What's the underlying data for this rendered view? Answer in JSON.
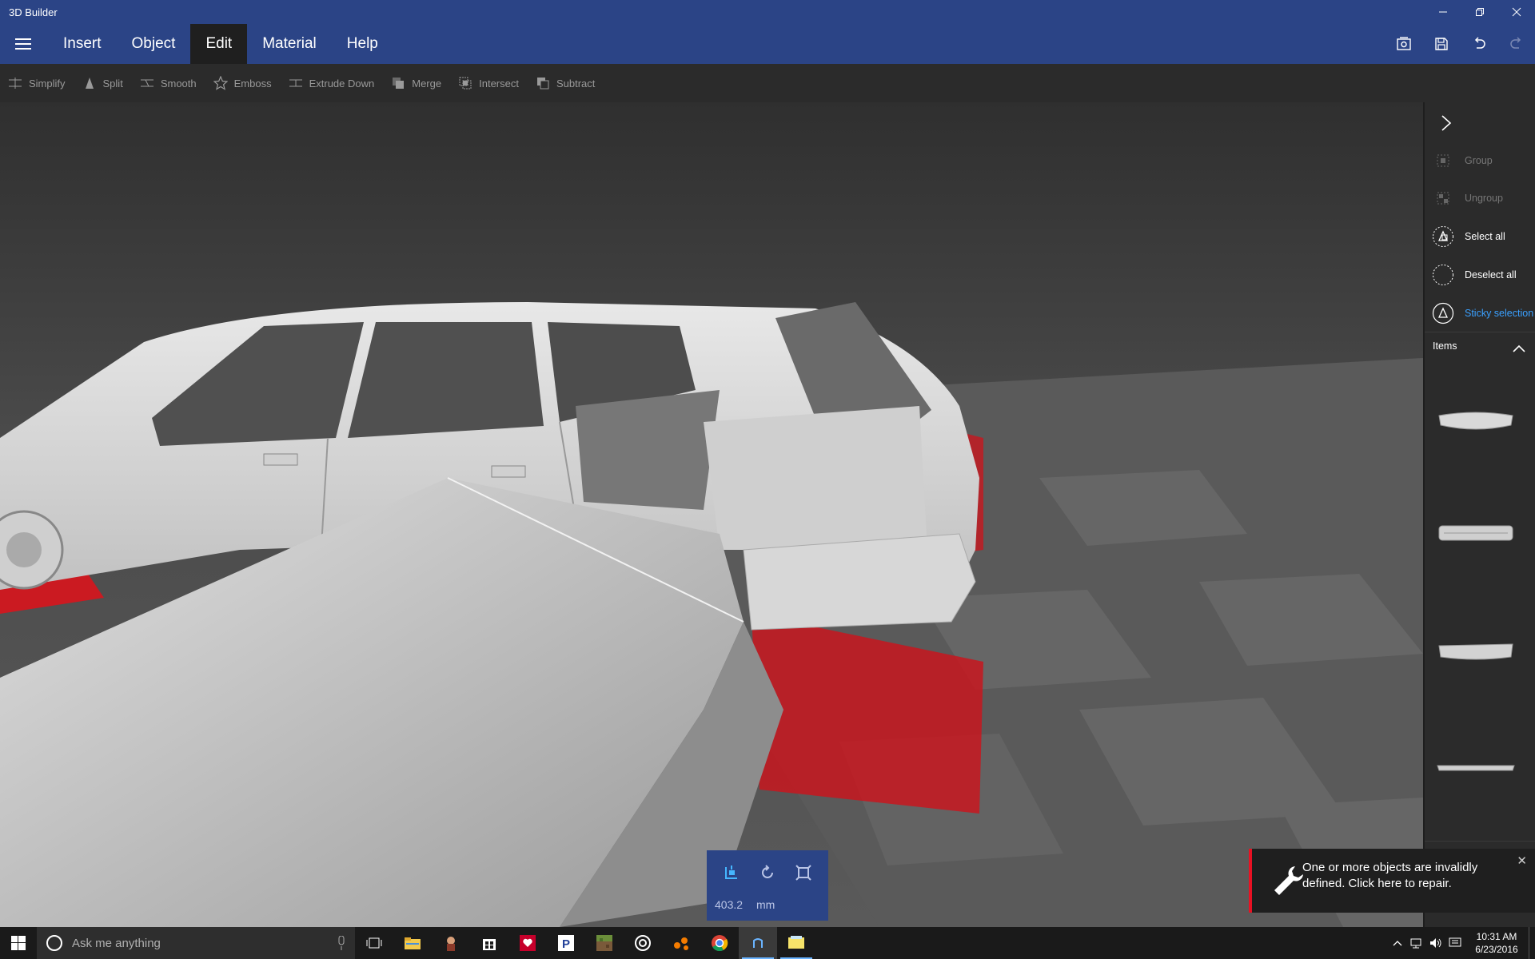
{
  "window": {
    "title": "3D Builder"
  },
  "menu": {
    "items": [
      {
        "label": "Insert",
        "active": false
      },
      {
        "label": "Object",
        "active": false
      },
      {
        "label": "Edit",
        "active": true
      },
      {
        "label": "Material",
        "active": false
      },
      {
        "label": "Help",
        "active": false
      }
    ]
  },
  "toolbar": {
    "tools": [
      {
        "label": "Simplify",
        "icon": "simplify-icon"
      },
      {
        "label": "Split",
        "icon": "split-icon"
      },
      {
        "label": "Smooth",
        "icon": "smooth-icon"
      },
      {
        "label": "Emboss",
        "icon": "star-icon"
      },
      {
        "label": "Extrude Down",
        "icon": "extrude-icon"
      },
      {
        "label": "Merge",
        "icon": "merge-icon"
      },
      {
        "label": "Intersect",
        "icon": "intersect-icon"
      },
      {
        "label": "Subtract",
        "icon": "subtract-icon"
      }
    ]
  },
  "transform": {
    "value": "403.2",
    "unit": "mm"
  },
  "panel": {
    "group": "Group",
    "ungroup": "Ungroup",
    "select_all": "Select all",
    "deselect_all": "Deselect all",
    "sticky_selection": "Sticky selection",
    "items_label": "Items"
  },
  "toast": {
    "message": "One or more objects are invalidly defined. Click here to repair."
  },
  "taskbar": {
    "search_placeholder": "Ask me anything",
    "time": "10:31 AM",
    "date": "6/23/2016"
  },
  "colors": {
    "accent": "#2b4486",
    "error": "#e81123",
    "link": "#3aa0ff"
  }
}
